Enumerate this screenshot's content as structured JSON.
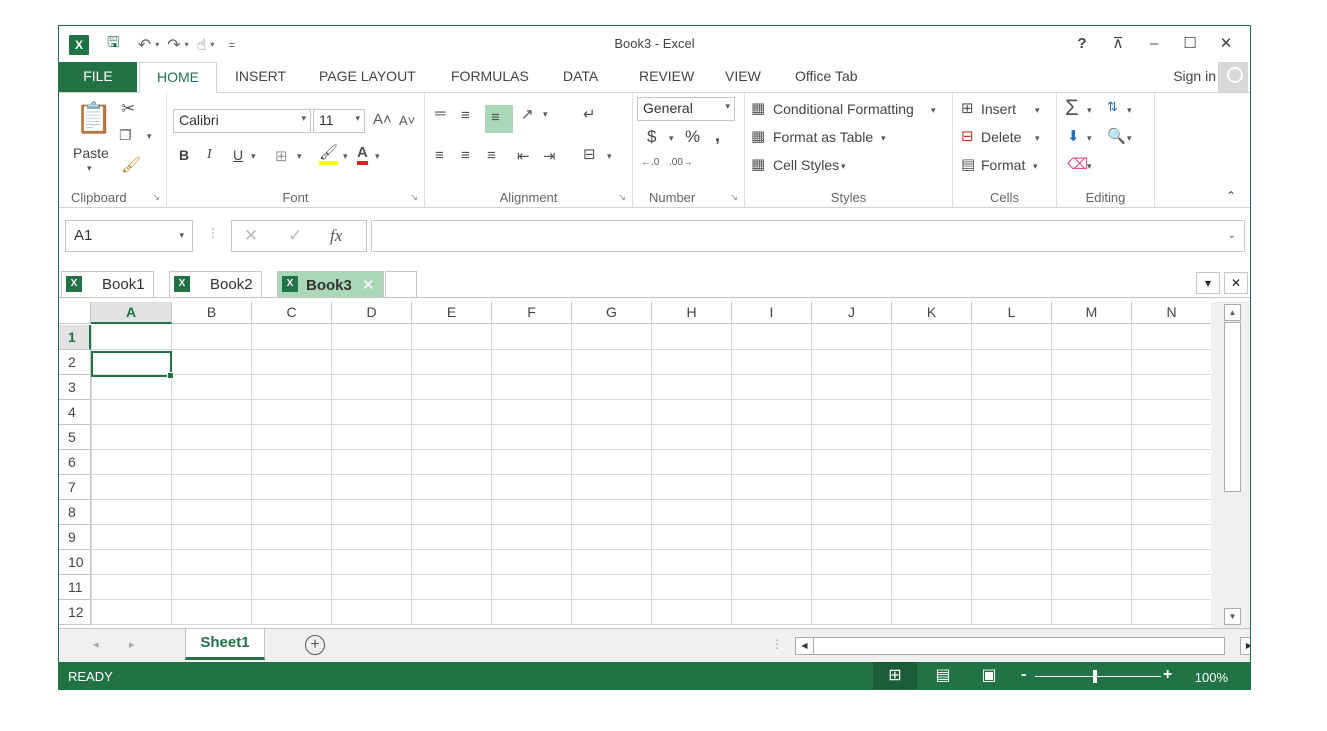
{
  "window": {
    "title": "Book3 - Excel"
  },
  "qat": {
    "logo": "X",
    "save_icon": "save-icon",
    "undo_icon": "undo-icon",
    "redo_icon": "redo-icon",
    "touch_icon": "touch-mode-icon",
    "customize": "="
  },
  "window_controls": {
    "help": "?",
    "restore_ribbon": "⊼",
    "minimize": "–",
    "maximize": "☐",
    "close": "✕"
  },
  "tabs": [
    {
      "label": "FILE"
    },
    {
      "label": "HOME"
    },
    {
      "label": "INSERT"
    },
    {
      "label": "PAGE LAYOUT"
    },
    {
      "label": "FORMULAS"
    },
    {
      "label": "DATA"
    },
    {
      "label": "REVIEW"
    },
    {
      "label": "VIEW"
    },
    {
      "label": "Office Tab"
    }
  ],
  "account": {
    "sign_in": "Sign in"
  },
  "ribbon": {
    "clipboard": {
      "label": "Clipboard",
      "paste": "Paste"
    },
    "font": {
      "label": "Font",
      "name": "Calibri",
      "size": "11",
      "bold": "B",
      "italic": "I",
      "underline": "U"
    },
    "alignment": {
      "label": "Alignment"
    },
    "number": {
      "label": "Number",
      "format": "General",
      "currency": "$",
      "percent": "%",
      "comma": ","
    },
    "styles": {
      "label": "Styles",
      "conditional": "Conditional Formatting",
      "format_table": "Format as Table",
      "cell_styles": "Cell Styles"
    },
    "cells": {
      "label": "Cells",
      "insert": "Insert",
      "delete": "Delete",
      "format": "Format"
    },
    "editing": {
      "label": "Editing"
    }
  },
  "formula_bar": {
    "name_box": "A1",
    "cancel": "✕",
    "enter": "✓",
    "fx": "fx",
    "value": ""
  },
  "office_tabs": [
    {
      "label": "Book1"
    },
    {
      "label": "Book2"
    },
    {
      "label": "Book3"
    }
  ],
  "grid": {
    "columns": [
      "A",
      "B",
      "C",
      "D",
      "E",
      "F",
      "G",
      "H",
      "I",
      "J",
      "K",
      "L",
      "M",
      "N"
    ],
    "rows": [
      "1",
      "2",
      "3",
      "4",
      "5",
      "6",
      "7",
      "8",
      "9",
      "10",
      "11",
      "12"
    ],
    "active_cell": "A1"
  },
  "sheets": [
    {
      "label": "Sheet1"
    }
  ],
  "status": {
    "mode": "READY",
    "zoom": "100%"
  }
}
